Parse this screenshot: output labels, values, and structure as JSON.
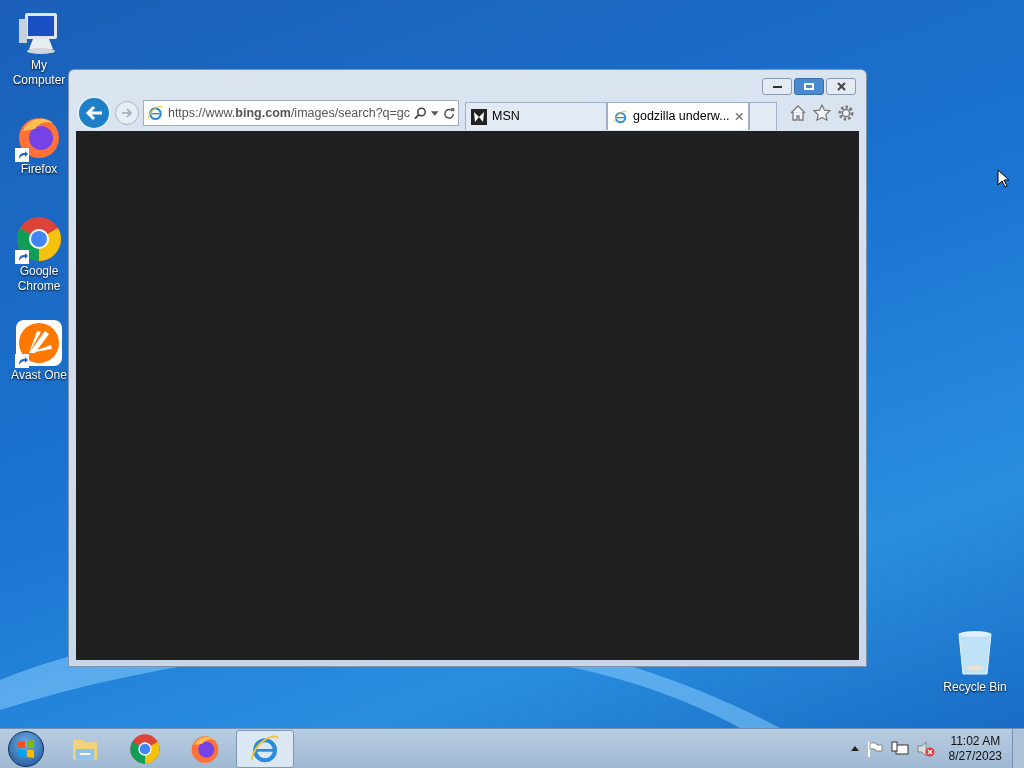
{
  "desktop_icons": [
    {
      "kind": "computer",
      "label": "My Computer"
    },
    {
      "kind": "firefox",
      "label": "Firefox"
    },
    {
      "kind": "chrome",
      "label": "Google Chrome"
    },
    {
      "kind": "avast",
      "label": "Avast One"
    }
  ],
  "recycle_bin": {
    "label": "Recycle Bin"
  },
  "browser": {
    "address": "https://www.**bing.com**/images/search?q=gc",
    "tabs": [
      {
        "kind": "msn",
        "label": "MSN",
        "selected": false
      },
      {
        "kind": "ie",
        "label": "godzilla underw...",
        "selected": true
      }
    ]
  },
  "taskbar": {
    "items": [
      {
        "kind": "explorer",
        "selected": false
      },
      {
        "kind": "chrome",
        "selected": false
      },
      {
        "kind": "firefox",
        "selected": false
      },
      {
        "kind": "ie",
        "selected": true
      }
    ],
    "time": "11:02 AM",
    "date": "8/27/2023"
  }
}
